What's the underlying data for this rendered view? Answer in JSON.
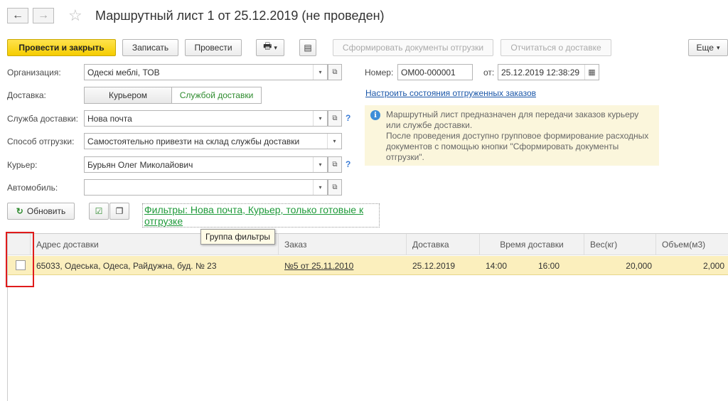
{
  "window": {
    "title": "Маршрутный лист 1 от 25.12.2019 (не проведен)",
    "back_icon": "←",
    "forward_icon": "→",
    "star_icon": "☆"
  },
  "toolbar": {
    "post_close": "Провести и закрыть",
    "save": "Записать",
    "post": "Провести",
    "print_icon": "🖶",
    "dropdown_icon": "▾",
    "report_icon": "▤",
    "form_shipping_docs": "Сформировать документы отгрузки",
    "report_delivery": "Отчитаться о доставке",
    "more": "Еще",
    "more_arrow": "▾"
  },
  "form": {
    "organization_label": "Организация:",
    "organization_value": "Одескі меблі, ТОВ",
    "delivery_label": "Доставка:",
    "delivery_opt_courier": "Курьером",
    "delivery_opt_service": "Службой доставки",
    "service_label": "Служба доставки:",
    "service_value": "Нова почта",
    "shipping_method_label": "Способ отгрузки:",
    "shipping_method_value": "Самостоятельно привезти на склад службы доставки",
    "courier_label": "Курьер:",
    "courier_value": "Бурьян Олег Миколайович",
    "car_label": "Автомобиль:",
    "car_value": "",
    "number_label": "Номер:",
    "number_value": "ОМ00-000001",
    "date_label": "от:",
    "date_value": "25.12.2019 12:38:29",
    "calendar_icon": "▦",
    "dropdown_glyph": "▾",
    "open_glyph": "⧉",
    "help_glyph": "?"
  },
  "info": {
    "link": "Настроить состояния отгруженных заказов",
    "icon": "i",
    "line1": "Маршрутный лист предназначен для передачи заказов курьеру",
    "line2": "или службе доставки.",
    "line3": "После проведения доступно групповое формирование расходных",
    "line4": "документов с помощью кнопки \"Сформировать документы",
    "line5": "отгрузки\"."
  },
  "filters": {
    "refresh": "Обновить",
    "refresh_icon": "↻",
    "check_all_icon": "☑",
    "uncheck_all_icon": "❐",
    "filter_link": "Фильтры: Нова почта, Курьер, только готовые к отгрузке",
    "tooltip": "Группа фильтры"
  },
  "table": {
    "headers": {
      "address": "Адрес доставки",
      "order": "Заказ",
      "delivery": "Доставка",
      "time": "Время доставки",
      "weight": "Вес(кг)",
      "volume": "Объем(м3)"
    },
    "rows": [
      {
        "address": "65033, Одеська, Одеса, Райдужна, буд. № 23",
        "order": "№5 от 25.11.2010",
        "delivery": "25.12.2019",
        "time_from": "14:00",
        "time_to": "16:00",
        "weight": "20,000",
        "volume": "2,000"
      }
    ]
  }
}
